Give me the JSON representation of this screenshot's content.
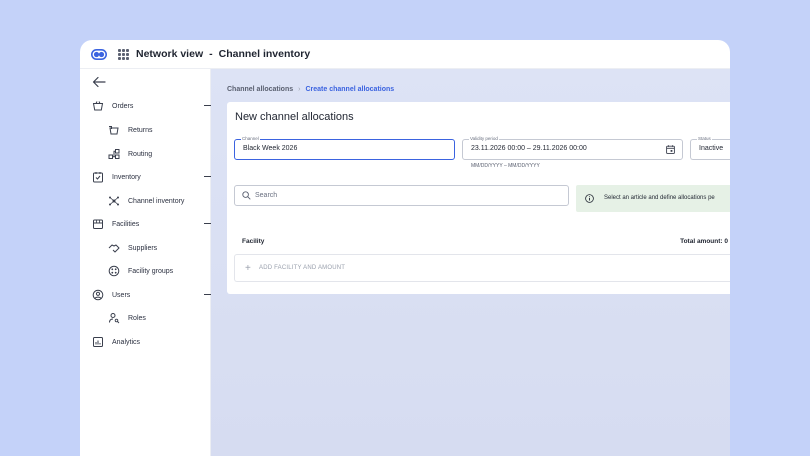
{
  "header": {
    "title": "Network view",
    "separator": "-",
    "subtitle": "Channel inventory"
  },
  "sidebar": {
    "items": [
      {
        "label": "Orders",
        "icon": "shopping-basket-icon",
        "collapsible": true
      },
      {
        "label": "Returns",
        "icon": "returns-icon"
      },
      {
        "label": "Routing",
        "icon": "routing-icon"
      },
      {
        "label": "Inventory",
        "icon": "clipboard-check-icon",
        "collapsible": true
      },
      {
        "label": "Channel inventory",
        "icon": "channel-network-icon"
      },
      {
        "label": "Facilities",
        "icon": "store-icon",
        "collapsible": true
      },
      {
        "label": "Suppliers",
        "icon": "handshake-icon"
      },
      {
        "label": "Facility groups",
        "icon": "grid-circle-icon"
      },
      {
        "label": "Users",
        "icon": "user-circle-icon",
        "collapsible": true
      },
      {
        "label": "Roles",
        "icon": "user-key-icon"
      },
      {
        "label": "Analytics",
        "icon": "chart-icon"
      }
    ]
  },
  "breadcrumb": {
    "parent": "Channel allocations",
    "current": "Create channel allocations"
  },
  "form": {
    "title": "New channel allocations",
    "channel": {
      "label": "Channel",
      "value": "Black Week 2026"
    },
    "validity": {
      "label": "Validity period",
      "value": "23.11.2026 00:00 – 29.11.2026 00:00",
      "hint": "MM/DD/YYYY – MM/DD/YYYY"
    },
    "status": {
      "label": "Status",
      "value": "Inactive"
    },
    "search": {
      "placeholder": "Search"
    },
    "info": "Select an article and define allocations pe",
    "table": {
      "facility_header": "Facility",
      "total_amount": "Total amount: 0",
      "add_label": "ADD FACILITY AND AMOUNT"
    }
  },
  "colors": {
    "background": "#c4d2f9",
    "accent": "#3b63e0",
    "info_bg": "#e6f1e6",
    "main_bg": "#dde3f5"
  }
}
